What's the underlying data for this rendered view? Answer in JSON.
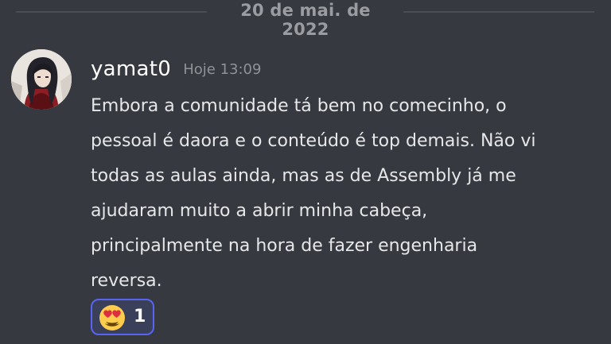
{
  "divider": {
    "date": "20 de mai. de 2022"
  },
  "message": {
    "author": "yamat0",
    "timestamp": "Hoje 13:09",
    "lines": [
      "Embora a comunidade tá bem no comecinho, o",
      "pessoal é daora e o conteúdo é top demais. Não vi",
      "todas as aulas ainda, mas as de Assembly já me",
      "ajudaram muito a abrir minha cabeça,",
      "principalmente na hora de fazer engenharia",
      "reversa."
    ],
    "reaction": {
      "emoji_icon": "heart-eyes-emoji-icon",
      "count": "1",
      "highlight_color": "#5865f2"
    }
  },
  "colors": {
    "background": "#36393f",
    "text": "#e6e7e9",
    "muted": "#8f9297"
  }
}
